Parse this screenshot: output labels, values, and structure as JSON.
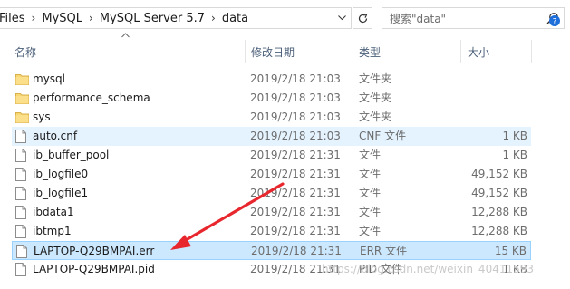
{
  "address": {
    "crumbs": [
      "Files",
      "MySQL",
      "MySQL Server 5.7",
      "data"
    ],
    "separator": "›"
  },
  "search": {
    "placeholder": "搜索\"data\""
  },
  "columns": {
    "name": "名称",
    "date": "修改日期",
    "type": "类型",
    "size": "大小"
  },
  "rows": [
    {
      "name": "mysql",
      "date": "2019/2/18 21:03",
      "type": "文件夹",
      "size": "",
      "icon": "folder-icon",
      "state": ""
    },
    {
      "name": "performance_schema",
      "date": "2019/2/18 21:03",
      "type": "文件夹",
      "size": "",
      "icon": "folder-icon",
      "state": ""
    },
    {
      "name": "sys",
      "date": "2019/2/18 21:03",
      "type": "文件夹",
      "size": "",
      "icon": "folder-icon",
      "state": ""
    },
    {
      "name": "auto.cnf",
      "date": "2019/2/18 21:03",
      "type": "CNF 文件",
      "size": "1 KB",
      "icon": "file-icon",
      "state": "hover"
    },
    {
      "name": "ib_buffer_pool",
      "date": "2019/2/18 21:31",
      "type": "文件",
      "size": "1 KB",
      "icon": "file-icon",
      "state": ""
    },
    {
      "name": "ib_logfile0",
      "date": "2019/2/18 21:31",
      "type": "文件",
      "size": "49,152 KB",
      "icon": "file-icon",
      "state": ""
    },
    {
      "name": "ib_logfile1",
      "date": "2019/2/18 21:31",
      "type": "文件",
      "size": "49,152 KB",
      "icon": "file-icon",
      "state": ""
    },
    {
      "name": "ibdata1",
      "date": "2019/2/18 21:31",
      "type": "文件",
      "size": "12,288 KB",
      "icon": "file-icon",
      "state": ""
    },
    {
      "name": "ibtmp1",
      "date": "2019/2/18 21:31",
      "type": "文件",
      "size": "12,288 KB",
      "icon": "file-icon",
      "state": ""
    },
    {
      "name": "LAPTOP-Q29BMPAI.err",
      "date": "2019/2/18 21:31",
      "type": "ERR 文件",
      "size": "15 KB",
      "icon": "file-icon",
      "state": "selected"
    },
    {
      "name": "LAPTOP-Q29BMPAI.pid",
      "date": "2019/2/18 21:31",
      "type": "PID 文件",
      "size": "1 KB",
      "icon": "file-icon",
      "state": ""
    }
  ],
  "watermark": "https://blog.csdn.net/weixin_40411593",
  "colors": {
    "folder": "#f8d775",
    "hover_row": "#e5f3ff",
    "selected_row": "#cce8ff",
    "annotation_arrow": "#e8262d"
  }
}
